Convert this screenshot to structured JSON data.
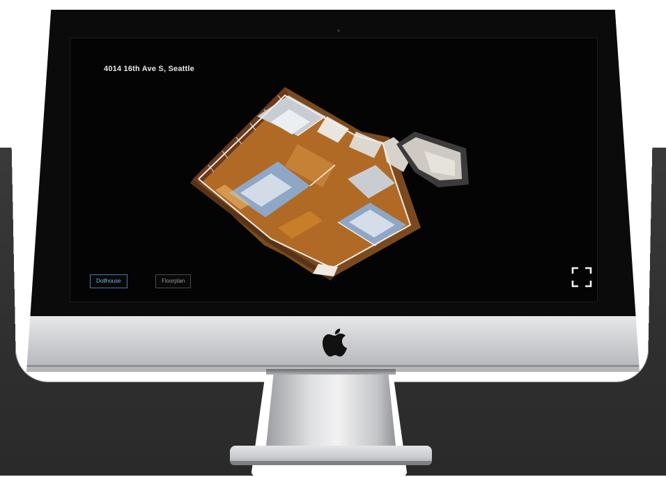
{
  "viewer": {
    "address": "4014 16th Ave S, Seattle",
    "buttons": {
      "dollhouse": "Dollhouse",
      "floorplan": "Floorplan"
    },
    "fullscreen_icon": "fullscreen-corners-icon",
    "active_mode": "dollhouse"
  },
  "device": {
    "type": "iMac",
    "logo_icon": "apple-logo-icon"
  },
  "colors": {
    "screen_background": "#040404",
    "active_button_border": "#4b7aa8",
    "active_button_text": "#7ab0e0",
    "inactive_button_border": "#4a4a4a",
    "floor_wood": "#b06a26",
    "backdrop": "#333333"
  }
}
